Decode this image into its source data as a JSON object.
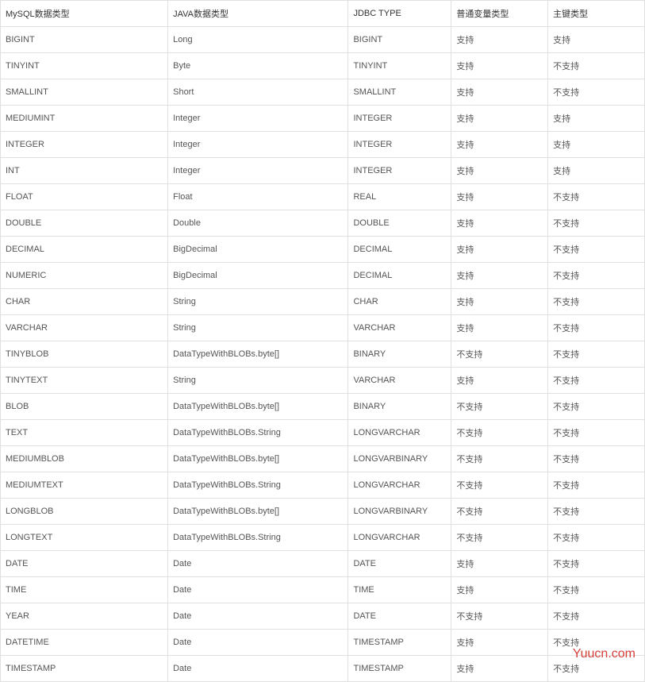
{
  "watermark": "Yuucn.com",
  "table": {
    "headers": [
      "MySQL数据类型",
      "JAVA数据类型",
      "JDBC TYPE",
      "普通变量类型",
      "主键类型"
    ],
    "rows": [
      [
        "BIGINT",
        "Long",
        "BIGINT",
        "支持",
        "支持"
      ],
      [
        "TINYINT",
        "Byte",
        "TINYINT",
        "支持",
        "不支持"
      ],
      [
        "SMALLINT",
        "Short",
        "SMALLINT",
        "支持",
        "不支持"
      ],
      [
        "MEDIUMINT",
        "Integer",
        "INTEGER",
        "支持",
        "支持"
      ],
      [
        "INTEGER",
        "Integer",
        "INTEGER",
        "支持",
        "支持"
      ],
      [
        "INT",
        "Integer",
        "INTEGER",
        "支持",
        "支持"
      ],
      [
        "FLOAT",
        "Float",
        "REAL",
        "支持",
        "不支持"
      ],
      [
        "DOUBLE",
        "Double",
        "DOUBLE",
        "支持",
        "不支持"
      ],
      [
        "DECIMAL",
        "BigDecimal",
        "DECIMAL",
        "支持",
        "不支持"
      ],
      [
        "NUMERIC",
        "BigDecimal",
        "DECIMAL",
        "支持",
        "不支持"
      ],
      [
        "CHAR",
        "String",
        "CHAR",
        "支持",
        "不支持"
      ],
      [
        "VARCHAR",
        "String",
        "VARCHAR",
        "支持",
        "不支持"
      ],
      [
        "TINYBLOB",
        "DataTypeWithBLOBs.byte[]",
        "BINARY",
        "不支持",
        "不支持"
      ],
      [
        "TINYTEXT",
        "String",
        "VARCHAR",
        "支持",
        "不支持"
      ],
      [
        "BLOB",
        "DataTypeWithBLOBs.byte[]",
        "BINARY",
        "不支持",
        "不支持"
      ],
      [
        "TEXT",
        "DataTypeWithBLOBs.String",
        "LONGVARCHAR",
        "不支持",
        "不支持"
      ],
      [
        "MEDIUMBLOB",
        "DataTypeWithBLOBs.byte[]",
        "LONGVARBINARY",
        "不支持",
        "不支持"
      ],
      [
        "MEDIUMTEXT",
        "DataTypeWithBLOBs.String",
        "LONGVARCHAR",
        "不支持",
        "不支持"
      ],
      [
        "LONGBLOB",
        "DataTypeWithBLOBs.byte[]",
        "LONGVARBINARY",
        "不支持",
        "不支持"
      ],
      [
        "LONGTEXT",
        "DataTypeWithBLOBs.String",
        "LONGVARCHAR",
        "不支持",
        "不支持"
      ],
      [
        "DATE",
        "Date",
        "DATE",
        "支持",
        "不支持"
      ],
      [
        "TIME",
        "Date",
        "TIME",
        "支持",
        "不支持"
      ],
      [
        "YEAR",
        "Date",
        "DATE",
        "不支持",
        "不支持"
      ],
      [
        "DATETIME",
        "Date",
        "TIMESTAMP",
        "支持",
        "不支持"
      ],
      [
        "TIMESTAMP",
        "Date",
        "TIMESTAMP",
        "支持",
        "不支持"
      ]
    ]
  },
  "chart_data": {
    "type": "table",
    "title": "MySQL to Java/JDBC Type Mapping",
    "columns": [
      "MySQL数据类型",
      "JAVA数据类型",
      "JDBC TYPE",
      "普通变量类型",
      "主键类型"
    ],
    "rows": [
      [
        "BIGINT",
        "Long",
        "BIGINT",
        "支持",
        "支持"
      ],
      [
        "TINYINT",
        "Byte",
        "TINYINT",
        "支持",
        "不支持"
      ],
      [
        "SMALLINT",
        "Short",
        "SMALLINT",
        "支持",
        "不支持"
      ],
      [
        "MEDIUMINT",
        "Integer",
        "INTEGER",
        "支持",
        "支持"
      ],
      [
        "INTEGER",
        "Integer",
        "INTEGER",
        "支持",
        "支持"
      ],
      [
        "INT",
        "Integer",
        "INTEGER",
        "支持",
        "支持"
      ],
      [
        "FLOAT",
        "Float",
        "REAL",
        "支持",
        "不支持"
      ],
      [
        "DOUBLE",
        "Double",
        "DOUBLE",
        "支持",
        "不支持"
      ],
      [
        "DECIMAL",
        "BigDecimal",
        "DECIMAL",
        "支持",
        "不支持"
      ],
      [
        "NUMERIC",
        "BigDecimal",
        "DECIMAL",
        "支持",
        "不支持"
      ],
      [
        "CHAR",
        "String",
        "CHAR",
        "支持",
        "不支持"
      ],
      [
        "VARCHAR",
        "String",
        "VARCHAR",
        "支持",
        "不支持"
      ],
      [
        "TINYBLOB",
        "DataTypeWithBLOBs.byte[]",
        "BINARY",
        "不支持",
        "不支持"
      ],
      [
        "TINYTEXT",
        "String",
        "VARCHAR",
        "支持",
        "不支持"
      ],
      [
        "BLOB",
        "DataTypeWithBLOBs.byte[]",
        "BINARY",
        "不支持",
        "不支持"
      ],
      [
        "TEXT",
        "DataTypeWithBLOBs.String",
        "LONGVARCHAR",
        "不支持",
        "不支持"
      ],
      [
        "MEDIUMBLOB",
        "DataTypeWithBLOBs.byte[]",
        "LONGVARBINARY",
        "不支持",
        "不支持"
      ],
      [
        "MEDIUMTEXT",
        "DataTypeWithBLOBs.String",
        "LONGVARCHAR",
        "不支持",
        "不支持"
      ],
      [
        "LONGBLOB",
        "DataTypeWithBLOBs.byte[]",
        "LONGVARBINARY",
        "不支持",
        "不支持"
      ],
      [
        "LONGTEXT",
        "DataTypeWithBLOBs.String",
        "LONGVARCHAR",
        "不支持",
        "不支持"
      ],
      [
        "DATE",
        "Date",
        "DATE",
        "支持",
        "不支持"
      ],
      [
        "TIME",
        "Date",
        "TIME",
        "支持",
        "不支持"
      ],
      [
        "YEAR",
        "Date",
        "DATE",
        "不支持",
        "不支持"
      ],
      [
        "DATETIME",
        "Date",
        "TIMESTAMP",
        "支持",
        "不支持"
      ],
      [
        "TIMESTAMP",
        "Date",
        "TIMESTAMP",
        "支持",
        "不支持"
      ]
    ]
  }
}
